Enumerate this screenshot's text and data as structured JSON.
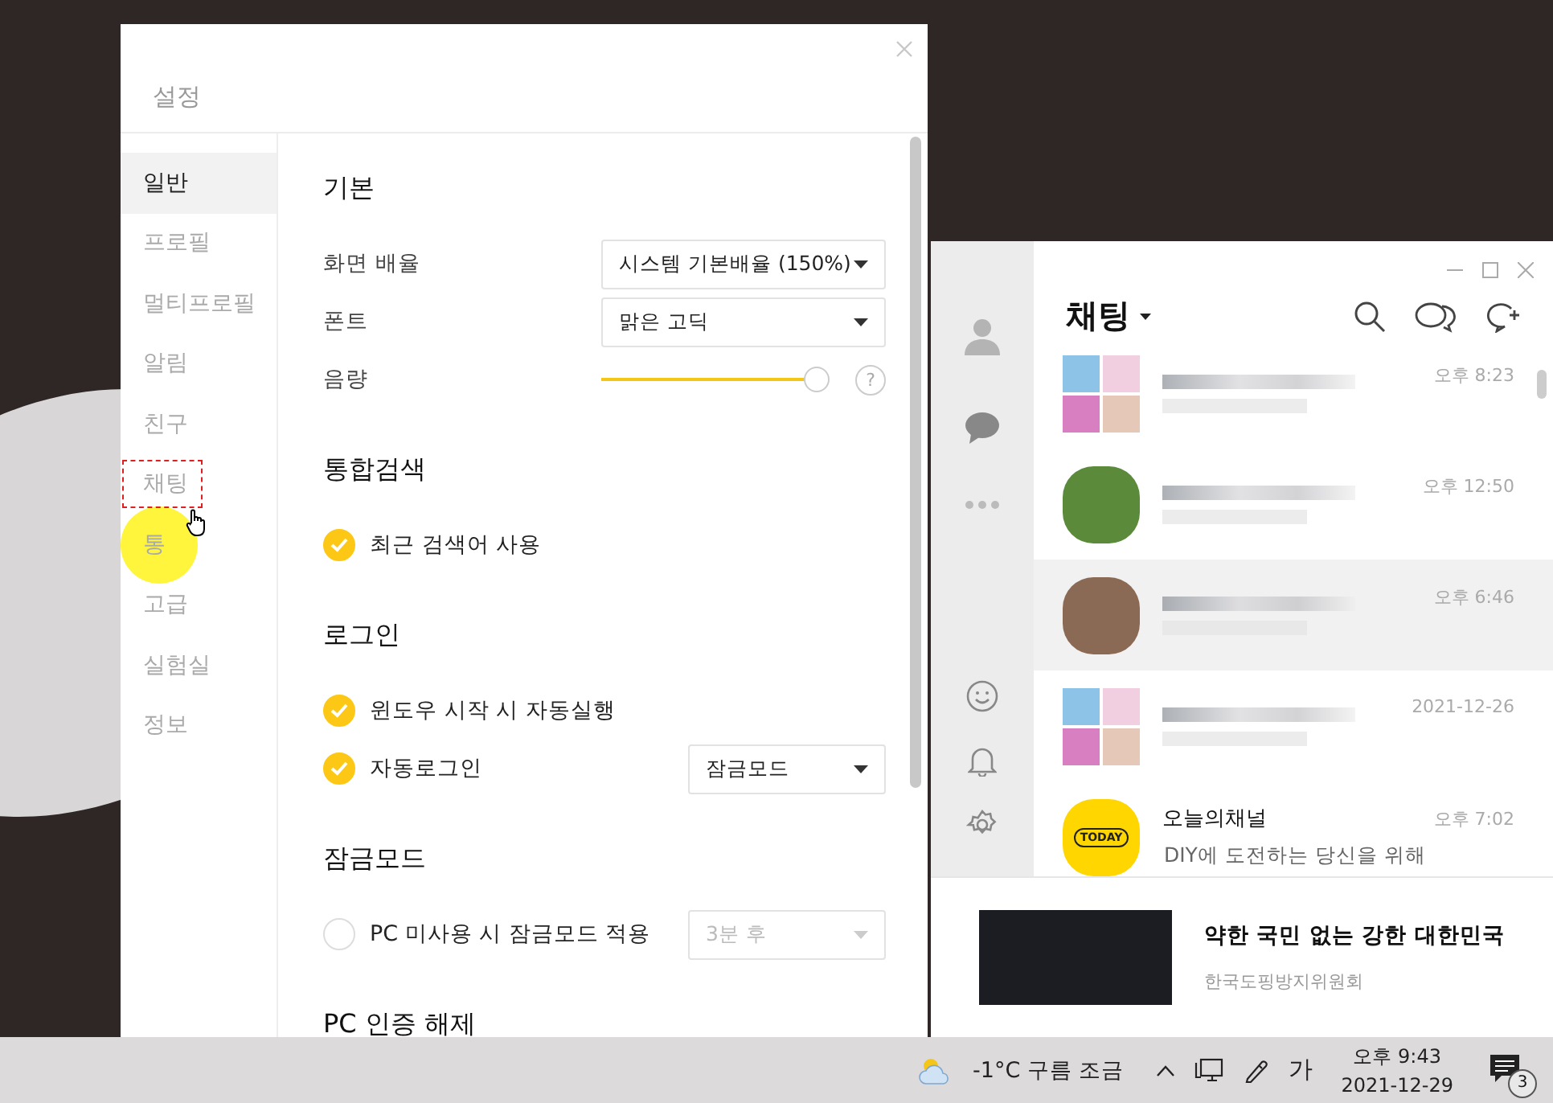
{
  "settings_window": {
    "title": "설정",
    "sidebar": {
      "items": [
        {
          "label": "일반",
          "selected": true,
          "highlighted": false,
          "pointer": false
        },
        {
          "label": "프로필",
          "selected": false,
          "highlighted": false,
          "pointer": false
        },
        {
          "label": "멀티프로필",
          "selected": false,
          "highlighted": false,
          "pointer": false
        },
        {
          "label": "알림",
          "selected": false,
          "highlighted": false,
          "pointer": false
        },
        {
          "label": "친구",
          "selected": false,
          "highlighted": false,
          "pointer": false
        },
        {
          "label": "채팅",
          "selected": false,
          "highlighted": true,
          "pointer": false
        },
        {
          "label": "통",
          "selected": false,
          "highlighted": false,
          "pointer": true
        },
        {
          "label": "고급",
          "selected": false,
          "highlighted": false,
          "pointer": false
        },
        {
          "label": "실험실",
          "selected": false,
          "highlighted": false,
          "pointer": false
        },
        {
          "label": "정보",
          "selected": false,
          "highlighted": false,
          "pointer": false
        }
      ]
    },
    "sections": [
      {
        "title": "기본",
        "rows": [
          {
            "kind": "select",
            "label": "화면 배율",
            "value": "시스템 기본배율 (150%)",
            "disabled": false
          },
          {
            "kind": "select",
            "label": "폰트",
            "value": "맑은 고딕",
            "disabled": false
          },
          {
            "kind": "slider",
            "label": "음량",
            "level": 1.0,
            "help": "?"
          }
        ]
      },
      {
        "title": "통합검색",
        "rows": [
          {
            "kind": "checkbox",
            "label": "최근 검색어 사용",
            "checked": true
          }
        ]
      },
      {
        "title": "로그인",
        "rows": [
          {
            "kind": "checkbox",
            "label": "윈도우 시작 시 자동실행",
            "checked": true
          },
          {
            "kind": "checkbox",
            "label": "자동로그인",
            "checked": true,
            "value": "잠금모드",
            "disabled": false
          }
        ]
      },
      {
        "title": "잠금모드",
        "rows": [
          {
            "kind": "checkbox",
            "label": "PC 미사용 시 잠금모드 적용",
            "checked": false,
            "value": "3분 후",
            "disabled": true
          }
        ]
      },
      {
        "title": "PC 인증 해제"
      }
    ]
  },
  "chat_window": {
    "title": "채팅",
    "rows": [
      {
        "kind": "group",
        "time": "오후 8:23",
        "selected": false
      },
      {
        "kind": "single",
        "time": "오후 12:50",
        "selected": false
      },
      {
        "kind": "single",
        "time": "오후 6:46",
        "selected": true
      },
      {
        "kind": "group",
        "time": "2021-12-26",
        "selected": false
      },
      {
        "kind": "channel",
        "logo_text": "TODAY",
        "name": "오늘의채널",
        "preview": "DIY에 도전하는 당신을 위해",
        "time": "오후 7:02",
        "selected": false
      }
    ],
    "ad": {
      "title": "약한 국민 없는 강한 대한민국",
      "sponsor": "한국도핑방지위원회"
    }
  },
  "taskbar": {
    "weather": "-1°C 구름 조금",
    "ime": "가",
    "time": "오후 9:43",
    "date": "2021-12-29",
    "notifications": "3"
  }
}
